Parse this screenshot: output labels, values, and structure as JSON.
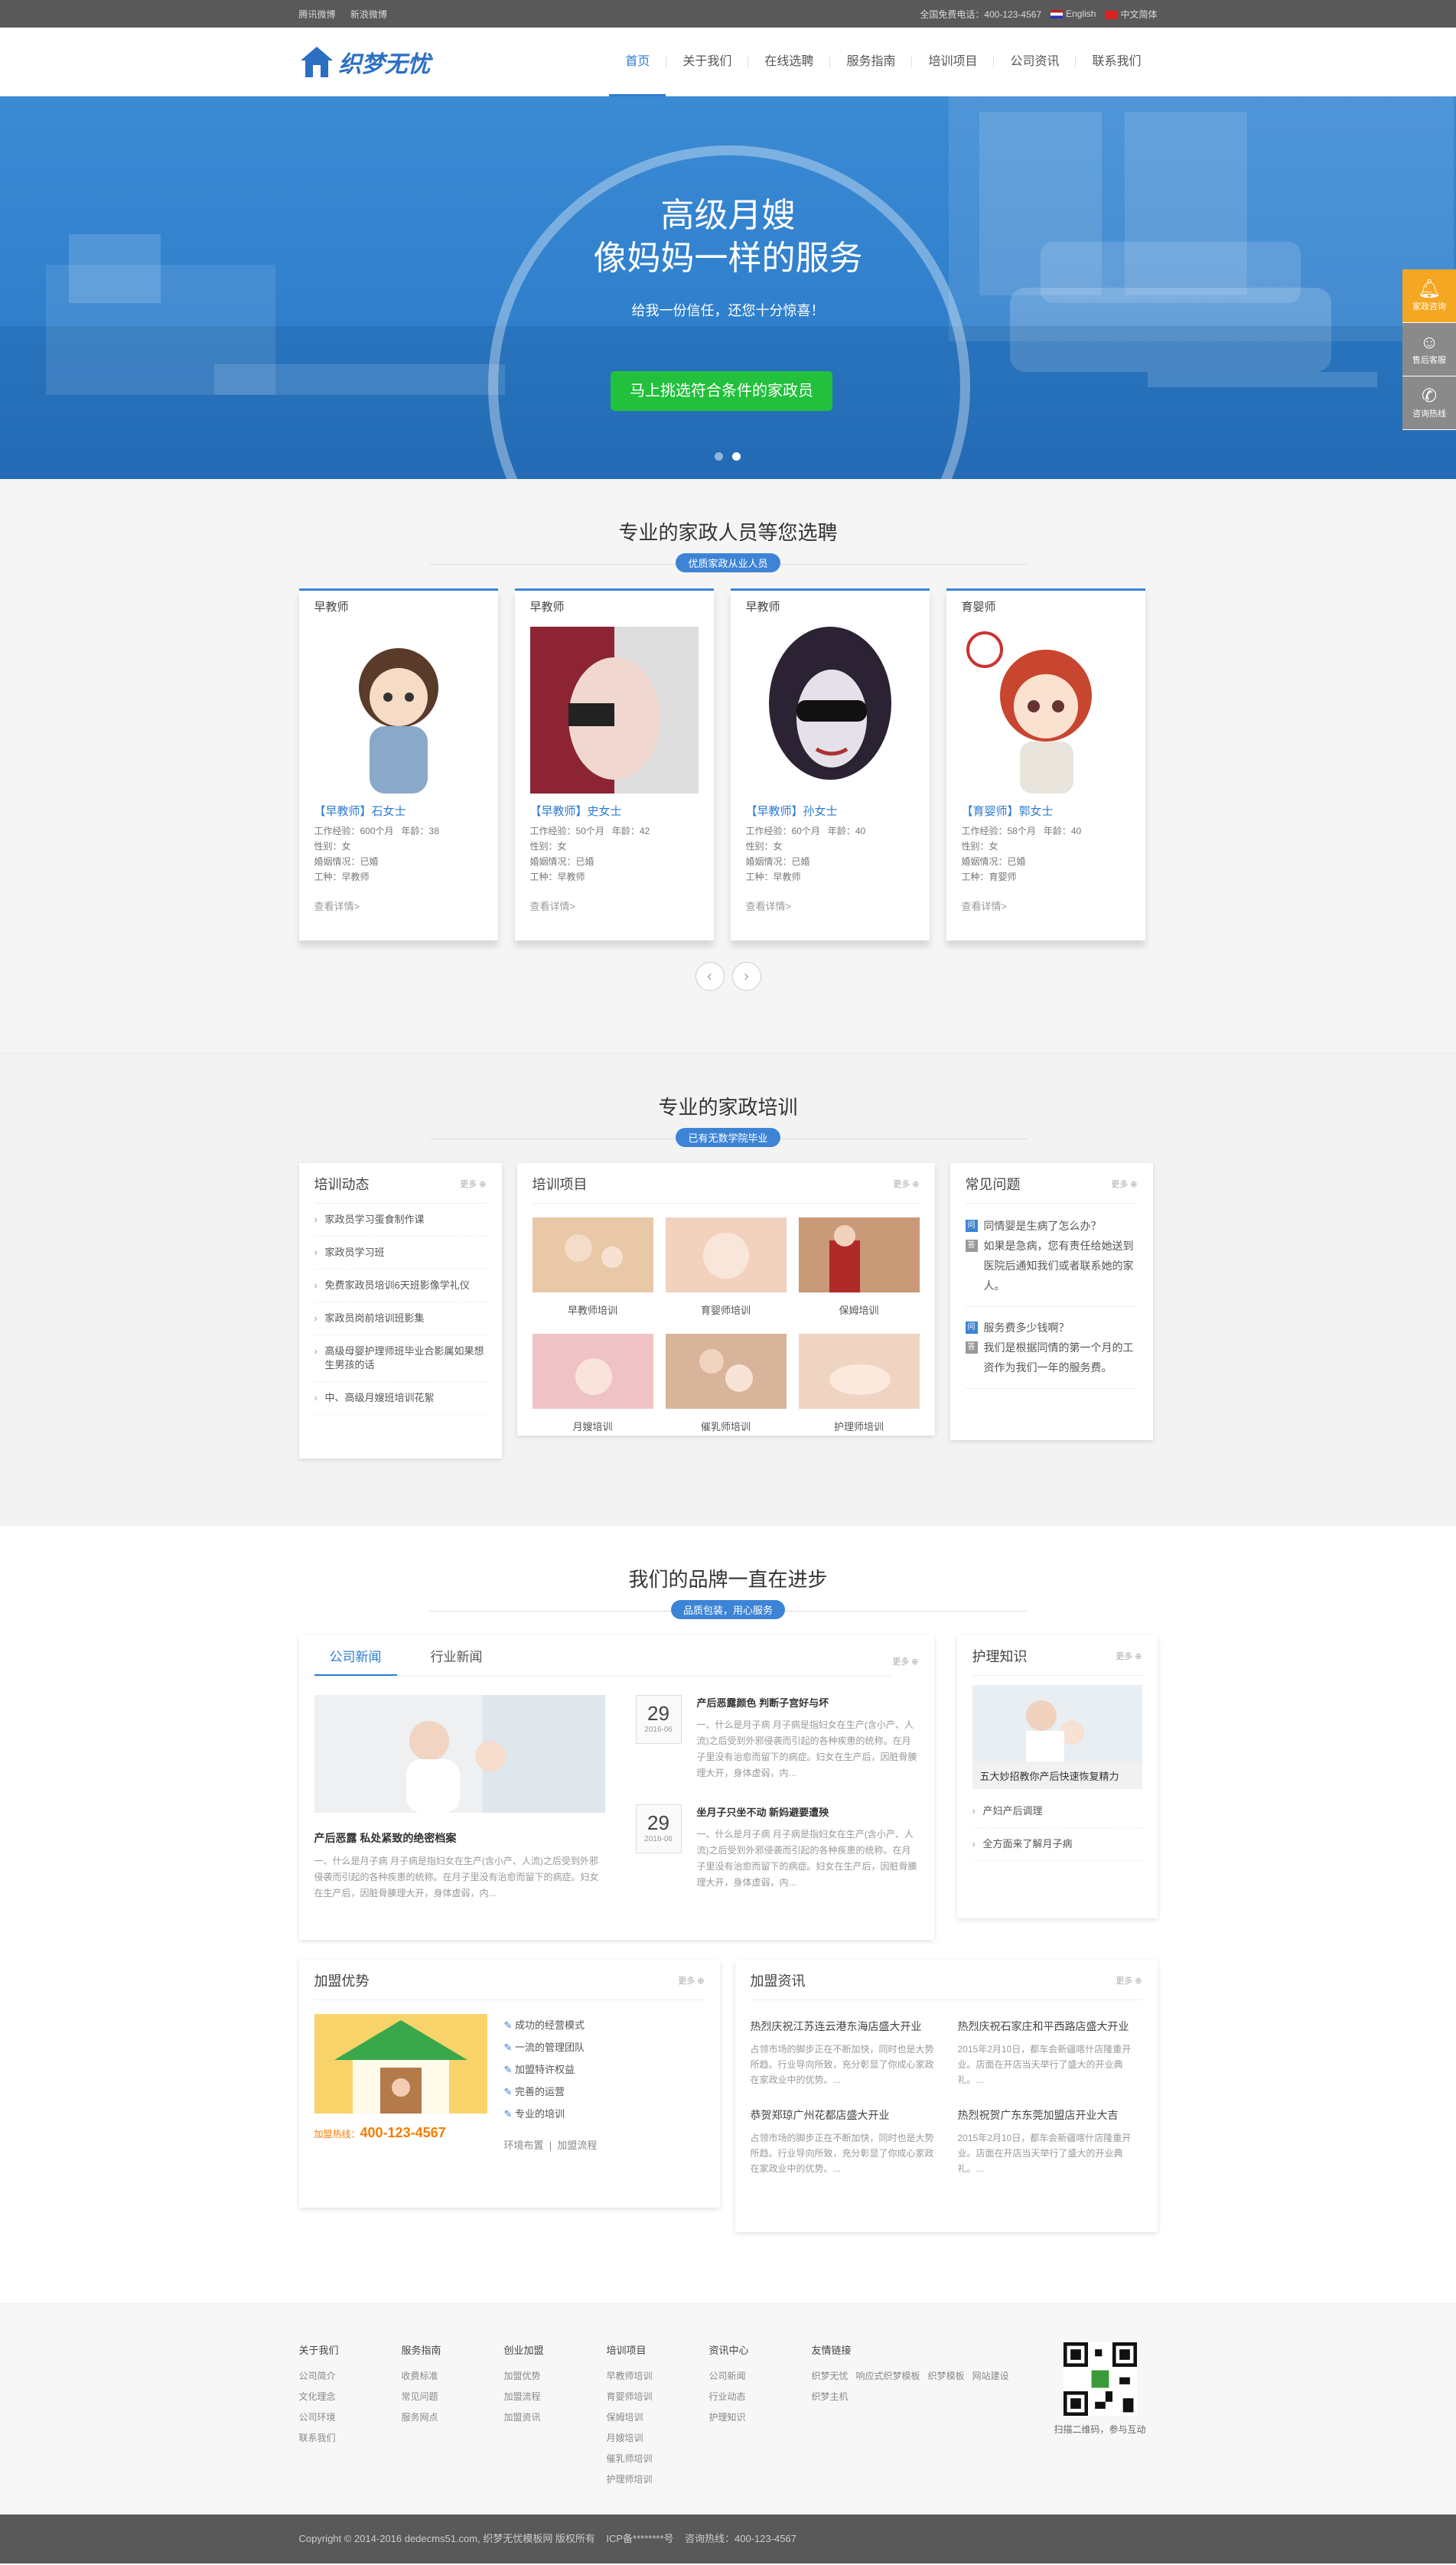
{
  "topbar": {
    "links": [
      "腾讯微博",
      "新浪微博"
    ],
    "hotline": "全国免费电话：400-123-4567",
    "lang_en": "English",
    "lang_cn": "中文简体"
  },
  "logo": {
    "text": "织梦无忧"
  },
  "nav": [
    {
      "label": "首页",
      "active": true
    },
    {
      "label": "关于我们"
    },
    {
      "label": "在线选聘"
    },
    {
      "label": "服务指南"
    },
    {
      "label": "培训项目"
    },
    {
      "label": "公司资讯"
    },
    {
      "label": "联系我们"
    }
  ],
  "hero": {
    "line1": "高级月嫂",
    "line2": "像妈妈一样的服务",
    "sub": "给我一份信任，还您十分惊喜！",
    "cta": "马上挑选符合条件的家政员",
    "slides": 2,
    "active_slide": 2
  },
  "side": [
    {
      "label": "家政咨询",
      "icon": "bell-icon"
    },
    {
      "label": "售后客服",
      "icon": "service-icon"
    },
    {
      "label": "咨询热线",
      "icon": "phone-icon"
    }
  ],
  "staff": {
    "title": "专业的家政人员等您选聘",
    "tag": "优质家政从业人员",
    "cards": [
      {
        "type": "早教师",
        "name": "【早教师】石女士",
        "exp": "工作经验：600个月",
        "age": "年龄：38",
        "gender": "性别：女",
        "marriage": "婚姻情况：已婚",
        "job": "工种：早教师",
        "more": "查看详情>",
        "color": "#e8d0b6"
      },
      {
        "type": "早教师",
        "name": "【早教师】史女士",
        "exp": "工作经验：50个月",
        "age": "年龄：42",
        "gender": "性别：女",
        "marriage": "婚姻情况：已婚",
        "job": "工种：早教师",
        "more": "查看详情>",
        "color": "#b63a4a"
      },
      {
        "type": "早教师",
        "name": "【早教师】孙女士",
        "exp": "工作经验：60个月",
        "age": "年龄：40",
        "gender": "性别：女",
        "marriage": "婚姻情况：已婚",
        "job": "工种：早教师",
        "more": "查看详情>",
        "color": "#3a3a44"
      },
      {
        "type": "育婴师",
        "name": "【育婴师】郭女士",
        "exp": "工作经验：58个月",
        "age": "年龄：40",
        "gender": "性别：女",
        "marriage": "婚姻情况：已婚",
        "job": "工种：育婴师",
        "more": "查看详情>",
        "color": "#d9564a"
      }
    ],
    "prev": "‹",
    "next": "›"
  },
  "training": {
    "title": "专业的家政培训",
    "tag": "已有无数学院毕业",
    "news": {
      "title": "培训动态",
      "more": "更多",
      "items": [
        "家政员学习蛋食制作课",
        "家政员学习班",
        "免费家政员培训6天班影像学礼仪",
        "家政员岗前培训班影集",
        "高级母婴护理师班毕业合影属如果想生男孩的话",
        "中、高级月嫂班培训花絮"
      ]
    },
    "projects": {
      "title": "培训项目",
      "more": "更多",
      "items": [
        {
          "label": "早教师培训",
          "color": "#e9c8a8"
        },
        {
          "label": "育婴师培训",
          "color": "#f2d2bf"
        },
        {
          "label": "保姆培训",
          "color": "#c99a78"
        },
        {
          "label": "月嫂培训",
          "color": "#efc3c6"
        },
        {
          "label": "催乳师培训",
          "color": "#d7b49a"
        },
        {
          "label": "护理师培训",
          "color": "#f0d4c2"
        }
      ]
    },
    "faq": {
      "title": "常见问题",
      "more": "更多",
      "items": [
        {
          "q": "同情婴是生病了怎么办？",
          "a": "如果是急病，您有责任给她送到医院后通知我们或者联系她的家人。"
        },
        {
          "q": "服务费多少钱啊？",
          "a": "我们是根据同情的第一个月的工资作为我们一年的服务费。"
        }
      ],
      "q_icon": "问",
      "a_icon": "答"
    }
  },
  "brand": {
    "title": "我们的品牌一直在进步",
    "tag": "品质包装，用心服务",
    "tabs": [
      "公司新闻",
      "行业新闻"
    ],
    "more": "更多",
    "feature": {
      "title": "产后恶露 私处紧致的绝密档案",
      "desc": "一、什么是月子病 月子病是指妇女在生产(含小产、人流)之后受到外邪侵袭而引起的各种疾患的统称。在月子里没有治愈而留下的病症。妇女在生产后，因脏骨腠理大开，身体虚弱，内..."
    },
    "dated": [
      {
        "day": "29",
        "ym": "2016-06",
        "title": "产后恶露颜色 判断子宫好与坏",
        "desc": "一、什么是月子病 月子病是指妇女在生产(含小产、人流)之后受到外邪侵袭而引起的各种疾患的统称。在月子里没有治愈而留下的病症。妇女在生产后，因脏骨腠理大开，身体虚弱，内..."
      },
      {
        "day": "29",
        "ym": "2016-06",
        "title": "坐月子只坐不动 新妈避要遭殃",
        "desc": "一、什么是月子病 月子病是指妇女在生产(含小产、人流)之后受到外邪侵袭而引起的各种疾患的统称。在月子里没有治愈而留下的病症。妇女在生产后，因脏骨腠理大开，身体虚弱，内..."
      }
    ],
    "care": {
      "title": "护理知识",
      "more": "更多",
      "feature": "五大妙招教你产后快速恢复精力",
      "items": [
        "产妇产后调理",
        "全方面来了解月子病"
      ]
    }
  },
  "join": {
    "adv": {
      "title": "加盟优势",
      "more": "更多",
      "items": [
        "成功的经营模式",
        "一流的管理团队",
        "加盟特许权益",
        "完善的运营",
        "专业的培训"
      ],
      "hotline_label": "加盟热线：",
      "hotline": "400-123-4567",
      "links": [
        "环境布置",
        "加盟流程"
      ]
    },
    "info": {
      "title": "加盟资讯",
      "more": "更多",
      "items": [
        {
          "title": "热烈庆祝江苏连云港东海店盛大开业",
          "desc": "占领市场的脚步正在不断加快，同时也是大势所趋。行业导向所致，充分彰显了你成心家政在家政业中的优势。..."
        },
        {
          "title": "热烈庆祝石家庄和平西路店盛大开业",
          "desc": "2015年2月10日，都车会新疆喀什店隆重开业。店面在开店当天举行了盛大的开业典礼。..."
        },
        {
          "title": "恭贺郑琼广州花都店盛大开业",
          "desc": "占领市场的脚步正在不断加快，同时也是大势所趋。行业导向所致，充分彰显了你成心家政在家政业中的优势。..."
        },
        {
          "title": "热烈祝贺广东东莞加盟店开业大吉",
          "desc": "2015年2月10日，都车会新疆喀什店隆重开业。店面在开店当天举行了盛大的开业典礼。..."
        }
      ]
    }
  },
  "footer": {
    "cols": [
      {
        "title": "关于我们",
        "links": [
          "公司简介",
          "文化理念",
          "公司环境",
          "联系我们"
        ]
      },
      {
        "title": "服务指南",
        "links": [
          "收费标准",
          "常见问题",
          "服务网点"
        ]
      },
      {
        "title": "创业加盟",
        "links": [
          "加盟优势",
          "加盟流程",
          "加盟资讯"
        ]
      },
      {
        "title": "培训项目",
        "links": [
          "早教师培训",
          "育婴师培训",
          "保姆培训",
          "月嫂培训",
          "催乳师培训",
          "护理师培训"
        ]
      },
      {
        "title": "资讯中心",
        "links": [
          "公司新闻",
          "行业动态",
          "护理知识"
        ]
      },
      {
        "title": "友情链接",
        "links": [
          "织梦无忧",
          "响应式织梦模板",
          "织梦模板",
          "网站建设",
          "织梦主机"
        ]
      }
    ],
    "qr_caption": "扫描二维码，参与互动",
    "copyright": "Copyright © 2014-2016 dedecms51.com, 织梦无忧模板网 版权所有",
    "icp": "ICP备********号",
    "hotline": "咨询热线：400-123-4567"
  }
}
